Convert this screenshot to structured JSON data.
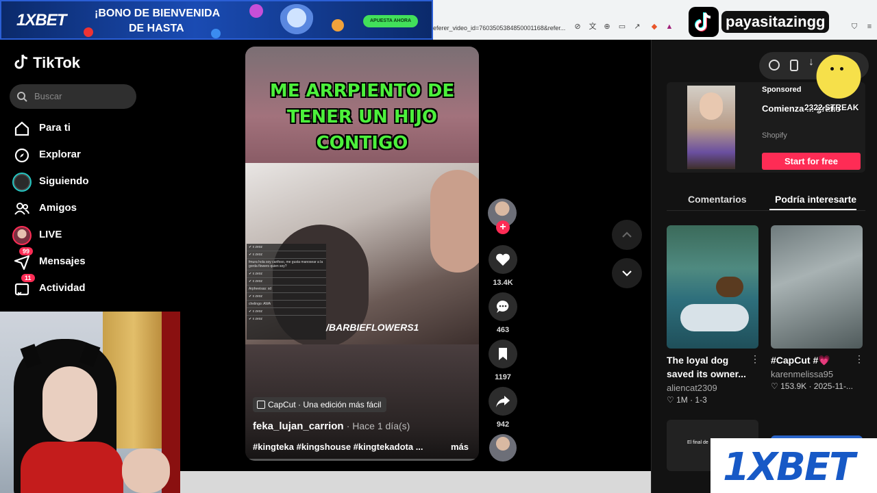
{
  "browser": {
    "url": "eferer_video_id=7603505384850001168&refer..."
  },
  "banner": {
    "logo": "1XBET",
    "line1": "¡BONO DE BIENVENIDA",
    "line2": "DE HASTA",
    "cta": "APUESTA AHORA"
  },
  "streamer": {
    "name": "payasitazingg"
  },
  "sidebar": {
    "logo": "TikTok",
    "search_placeholder": "Buscar",
    "items": [
      {
        "label": "Para ti",
        "icon": "home-icon"
      },
      {
        "label": "Explorar",
        "icon": "compass-icon"
      },
      {
        "label": "Siguiendo",
        "icon": "following-avatar"
      },
      {
        "label": "Amigos",
        "icon": "friends-icon"
      },
      {
        "label": "LIVE",
        "icon": "live-avatar"
      },
      {
        "label": "Mensajes",
        "icon": "messages-icon",
        "badge": "99"
      },
      {
        "label": "Actividad",
        "icon": "activity-icon",
        "badge": "11"
      }
    ]
  },
  "video": {
    "caption_text": "ME ARRPIENTO DE TENER UN HIJO CONTIGO",
    "watermark": "/BARBIEFLOWERS1",
    "capcut": "CapCut · Una edición más fácil",
    "author": "feka_lujan_carrion",
    "time": "· Hace 1 día(s)",
    "tags": "#kingteka #kingshouse #kingtekadota ...",
    "more": "más",
    "chat_lines": [
      "✔ x zeoz",
      "✔ x zeoz",
      "fmura hola soy carifoso, me gusta manosear a la gorda flowers quien soy?",
      "✔ x zeoz",
      "✔ x zeoz",
      "Arpheeisas: xd",
      "✔ x zeoz",
      "chelingo: AWA",
      "✔ x zeoz",
      "✔ x zeoz"
    ]
  },
  "actions": {
    "likes": "13.4K",
    "comments": "463",
    "saves": "1197",
    "shares": "942"
  },
  "ad": {
    "sponsored": "Sponsored",
    "title": "Comienza ... gratis",
    "brand": "Shopify",
    "button": "Start for free"
  },
  "overlay": {
    "streak": "2322 STREAK"
  },
  "tabs": {
    "comments": "Comentarios",
    "suggested": "Podría interesarte"
  },
  "cards": [
    {
      "title": "The loyal dog saved its owner...",
      "user": "aliencat2309",
      "meta": "♡ 1M · 1-3"
    },
    {
      "title": "#CapCut #💗",
      "user": "karenmelissa95",
      "meta": "♡ 153.9K · 2025-11-..."
    }
  ],
  "cards_below": [
    {
      "text": "El final de"
    }
  ],
  "xbet": {
    "logo": "1XBET"
  },
  "colors": {
    "accent": "#fe2c55",
    "caption_green": "#4cf03b",
    "brand_blue": "#1759c6"
  }
}
